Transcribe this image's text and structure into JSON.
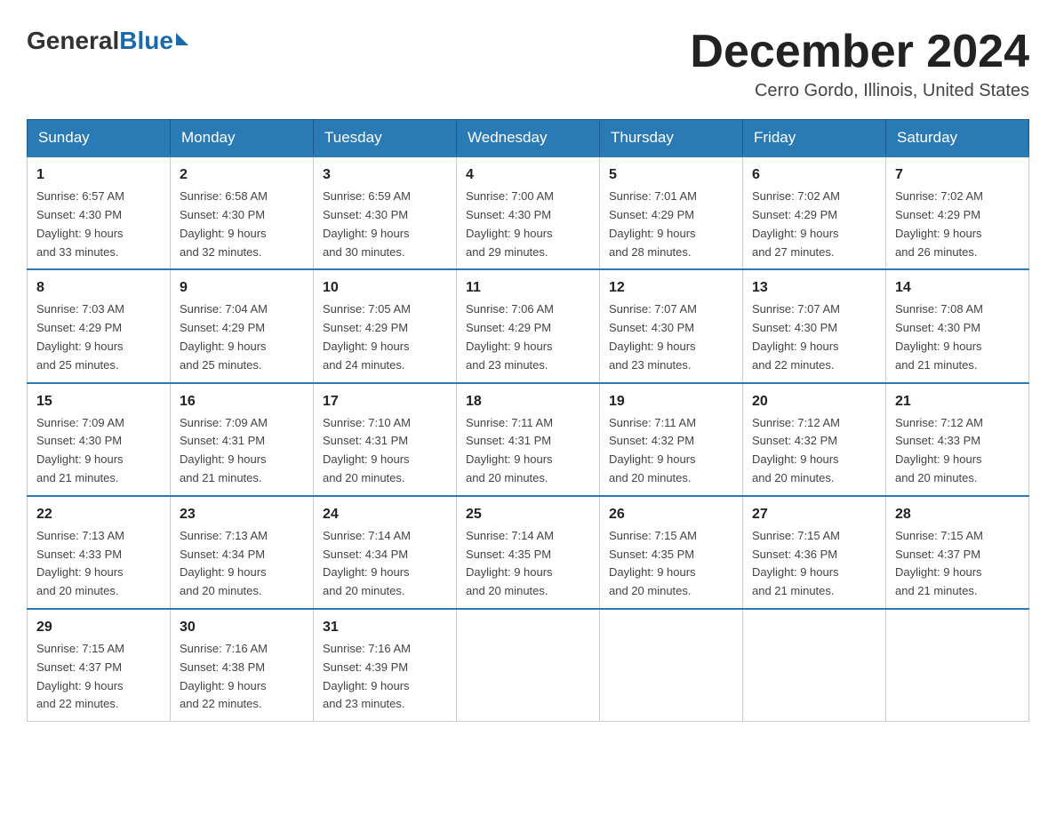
{
  "header": {
    "logo_general": "General",
    "logo_blue": "Blue",
    "month_title": "December 2024",
    "location": "Cerro Gordo, Illinois, United States"
  },
  "weekdays": [
    "Sunday",
    "Monday",
    "Tuesday",
    "Wednesday",
    "Thursday",
    "Friday",
    "Saturday"
  ],
  "weeks": [
    [
      {
        "day": "1",
        "sunrise": "6:57 AM",
        "sunset": "4:30 PM",
        "daylight": "9 hours and 33 minutes."
      },
      {
        "day": "2",
        "sunrise": "6:58 AM",
        "sunset": "4:30 PM",
        "daylight": "9 hours and 32 minutes."
      },
      {
        "day": "3",
        "sunrise": "6:59 AM",
        "sunset": "4:30 PM",
        "daylight": "9 hours and 30 minutes."
      },
      {
        "day": "4",
        "sunrise": "7:00 AM",
        "sunset": "4:30 PM",
        "daylight": "9 hours and 29 minutes."
      },
      {
        "day": "5",
        "sunrise": "7:01 AM",
        "sunset": "4:29 PM",
        "daylight": "9 hours and 28 minutes."
      },
      {
        "day": "6",
        "sunrise": "7:02 AM",
        "sunset": "4:29 PM",
        "daylight": "9 hours and 27 minutes."
      },
      {
        "day": "7",
        "sunrise": "7:02 AM",
        "sunset": "4:29 PM",
        "daylight": "9 hours and 26 minutes."
      }
    ],
    [
      {
        "day": "8",
        "sunrise": "7:03 AM",
        "sunset": "4:29 PM",
        "daylight": "9 hours and 25 minutes."
      },
      {
        "day": "9",
        "sunrise": "7:04 AM",
        "sunset": "4:29 PM",
        "daylight": "9 hours and 25 minutes."
      },
      {
        "day": "10",
        "sunrise": "7:05 AM",
        "sunset": "4:29 PM",
        "daylight": "9 hours and 24 minutes."
      },
      {
        "day": "11",
        "sunrise": "7:06 AM",
        "sunset": "4:29 PM",
        "daylight": "9 hours and 23 minutes."
      },
      {
        "day": "12",
        "sunrise": "7:07 AM",
        "sunset": "4:30 PM",
        "daylight": "9 hours and 23 minutes."
      },
      {
        "day": "13",
        "sunrise": "7:07 AM",
        "sunset": "4:30 PM",
        "daylight": "9 hours and 22 minutes."
      },
      {
        "day": "14",
        "sunrise": "7:08 AM",
        "sunset": "4:30 PM",
        "daylight": "9 hours and 21 minutes."
      }
    ],
    [
      {
        "day": "15",
        "sunrise": "7:09 AM",
        "sunset": "4:30 PM",
        "daylight": "9 hours and 21 minutes."
      },
      {
        "day": "16",
        "sunrise": "7:09 AM",
        "sunset": "4:31 PM",
        "daylight": "9 hours and 21 minutes."
      },
      {
        "day": "17",
        "sunrise": "7:10 AM",
        "sunset": "4:31 PM",
        "daylight": "9 hours and 20 minutes."
      },
      {
        "day": "18",
        "sunrise": "7:11 AM",
        "sunset": "4:31 PM",
        "daylight": "9 hours and 20 minutes."
      },
      {
        "day": "19",
        "sunrise": "7:11 AM",
        "sunset": "4:32 PM",
        "daylight": "9 hours and 20 minutes."
      },
      {
        "day": "20",
        "sunrise": "7:12 AM",
        "sunset": "4:32 PM",
        "daylight": "9 hours and 20 minutes."
      },
      {
        "day": "21",
        "sunrise": "7:12 AM",
        "sunset": "4:33 PM",
        "daylight": "9 hours and 20 minutes."
      }
    ],
    [
      {
        "day": "22",
        "sunrise": "7:13 AM",
        "sunset": "4:33 PM",
        "daylight": "9 hours and 20 minutes."
      },
      {
        "day": "23",
        "sunrise": "7:13 AM",
        "sunset": "4:34 PM",
        "daylight": "9 hours and 20 minutes."
      },
      {
        "day": "24",
        "sunrise": "7:14 AM",
        "sunset": "4:34 PM",
        "daylight": "9 hours and 20 minutes."
      },
      {
        "day": "25",
        "sunrise": "7:14 AM",
        "sunset": "4:35 PM",
        "daylight": "9 hours and 20 minutes."
      },
      {
        "day": "26",
        "sunrise": "7:15 AM",
        "sunset": "4:35 PM",
        "daylight": "9 hours and 20 minutes."
      },
      {
        "day": "27",
        "sunrise": "7:15 AM",
        "sunset": "4:36 PM",
        "daylight": "9 hours and 21 minutes."
      },
      {
        "day": "28",
        "sunrise": "7:15 AM",
        "sunset": "4:37 PM",
        "daylight": "9 hours and 21 minutes."
      }
    ],
    [
      {
        "day": "29",
        "sunrise": "7:15 AM",
        "sunset": "4:37 PM",
        "daylight": "9 hours and 22 minutes."
      },
      {
        "day": "30",
        "sunrise": "7:16 AM",
        "sunset": "4:38 PM",
        "daylight": "9 hours and 22 minutes."
      },
      {
        "day": "31",
        "sunrise": "7:16 AM",
        "sunset": "4:39 PM",
        "daylight": "9 hours and 23 minutes."
      },
      null,
      null,
      null,
      null
    ]
  ]
}
